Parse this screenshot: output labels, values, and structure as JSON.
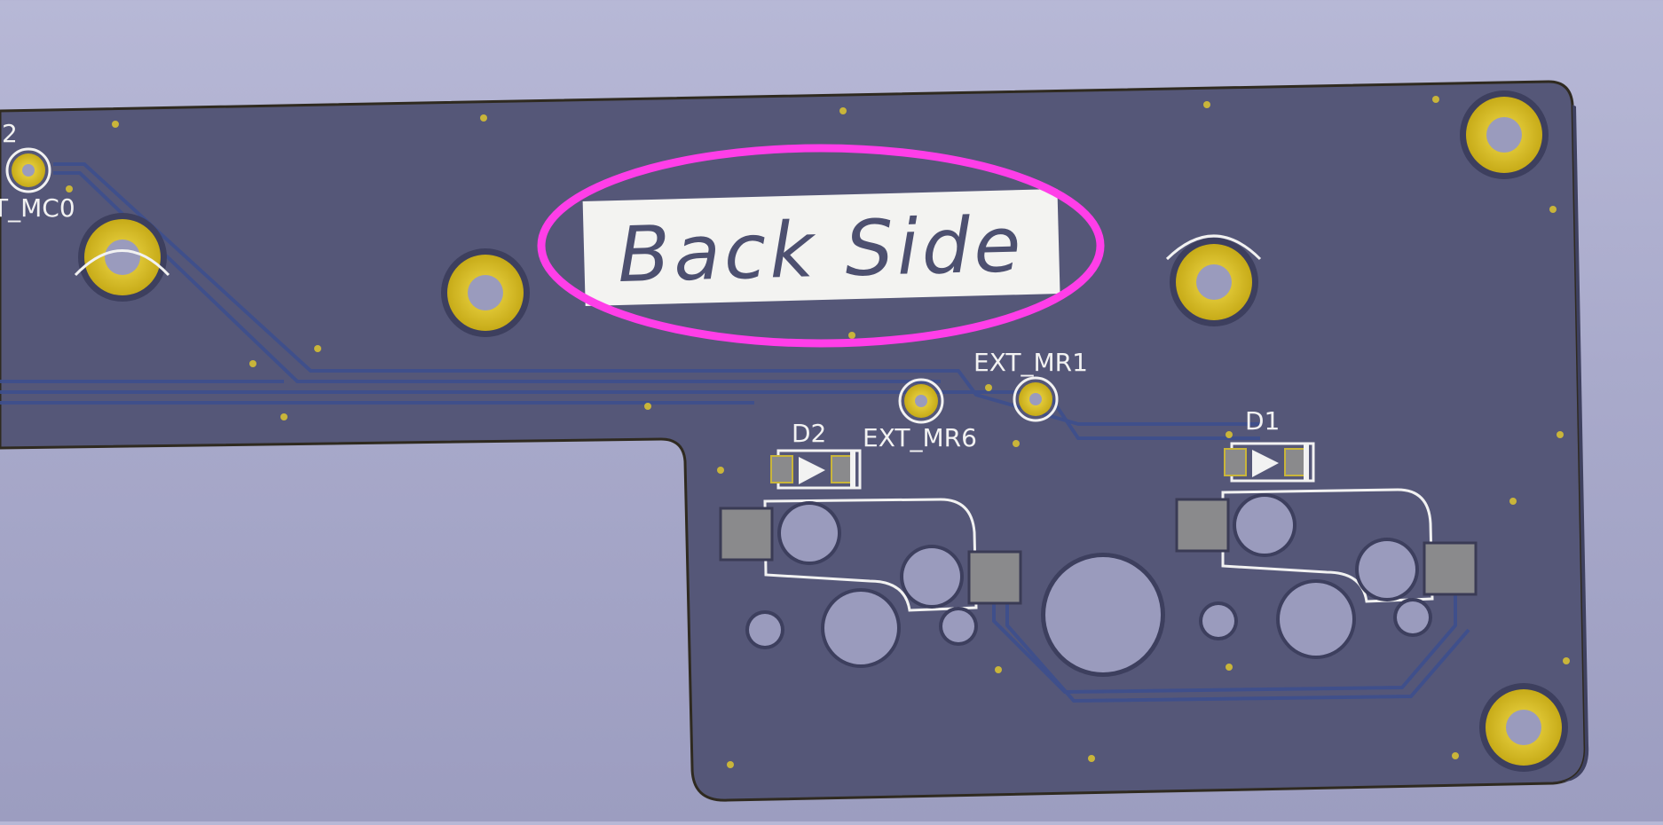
{
  "scene": {
    "title": "Back Side",
    "references": {
      "partial_left_number": "2",
      "partial_left_net": "T_MC0",
      "ext_mr1": "EXT_MR1",
      "ext_mr6": "EXT_MR6",
      "d1": "D1",
      "d2": "D2"
    }
  },
  "colors": {
    "background": "#b0b1d1",
    "board": "#555778",
    "trace": "#3a4d8c",
    "pad_gold": "#d7bf2c",
    "pad_smd": "#8a8a8c",
    "silkscreen": "#f2f2f2",
    "highlight": "#ff3ee8"
  }
}
